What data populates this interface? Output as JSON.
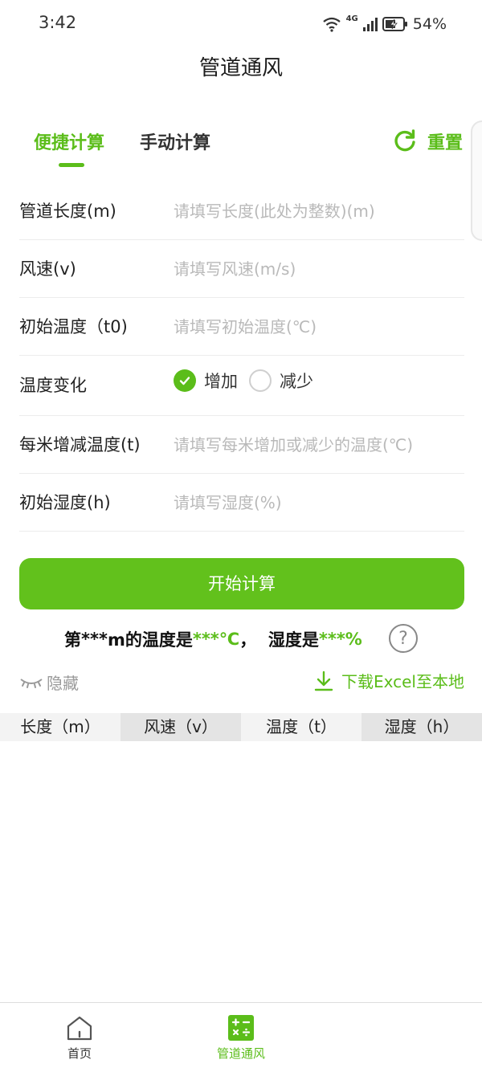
{
  "status_bar": {
    "time": "3:42",
    "network": "4G",
    "battery": "54%",
    "icons": [
      "wifi-icon",
      "signal-icon",
      "battery-charging-icon"
    ]
  },
  "header": {
    "title": "管道通风"
  },
  "tabs": [
    {
      "label": "便捷计算",
      "active": true
    },
    {
      "label": "手动计算",
      "active": false
    }
  ],
  "reset": {
    "label": "重置",
    "icon": "refresh-icon"
  },
  "form": {
    "length": {
      "label": "管道长度(m)",
      "value": "",
      "placeholder": "请填写长度(此处为整数)(m)"
    },
    "wind_speed": {
      "label": "风速(v)",
      "value": "",
      "placeholder": "请填写风速(m/s)"
    },
    "initial_temp": {
      "label": "初始温度（t0)",
      "value": "",
      "placeholder": "请填写初始温度(℃)"
    },
    "temp_change": {
      "label": "温度变化",
      "options": [
        {
          "label": "增加",
          "checked": true
        },
        {
          "label": "减少",
          "checked": false
        }
      ]
    },
    "temp_per_meter": {
      "label": "每米增减温度(t)",
      "value": "",
      "placeholder": "请填写每米增加或减少的温度(℃)"
    },
    "initial_humidity": {
      "label": "初始湿度(h)",
      "value": "",
      "placeholder": "请填写湿度(%)"
    }
  },
  "start_button": {
    "label": "开始计算"
  },
  "result": {
    "prefix": "第",
    "distance": "***",
    "mid1": "m的温度是",
    "temperature": "***℃",
    "mid2": "，  湿度是",
    "humidity": "***%"
  },
  "actions": {
    "hide_label": "隐藏",
    "download_label": "下载Excel至本地"
  },
  "table": {
    "columns": [
      "长度（m）",
      "风速（v）",
      "温度（t）",
      "湿度（h）"
    ]
  },
  "bottom_nav": [
    {
      "label": "首页",
      "icon": "home-icon",
      "active": false
    },
    {
      "label": "管道通风",
      "icon": "calculator-icon",
      "active": true
    }
  ],
  "colors": {
    "accent": "#5bbd1a",
    "button": "#62c11c",
    "placeholder": "#b9b9b9",
    "divider": "#ececec"
  }
}
